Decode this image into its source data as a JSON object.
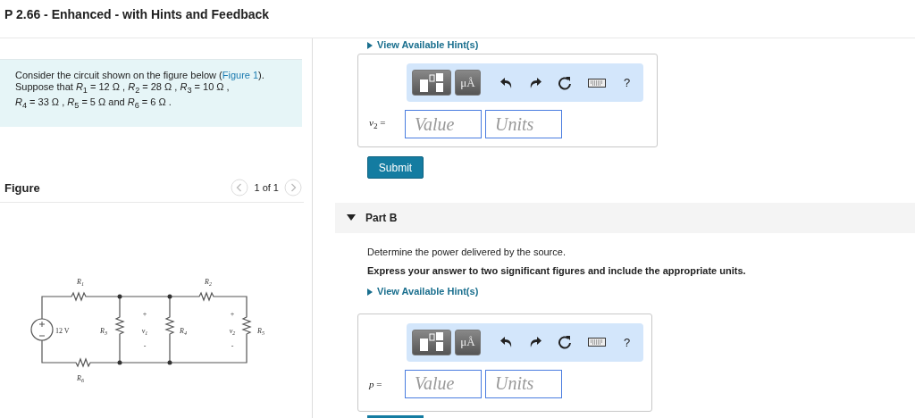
{
  "title": "P 2.66 - Enhanced - with Hints and Feedback",
  "problem": {
    "intro": "Consider the circuit shown on the figure below (",
    "link": "Figure 1",
    "intro_end": ").",
    "lines": [
      "Suppose that *R*$_{1}$ = 12 Ω , *R*$_{2}$ = 28 Ω , *R*$_{3}$ = 10 Ω ,",
      "*R*$_{4}$ = 33 Ω , *R*$_{5}$ = 5 Ω and *R*$_{6}$ = 6 Ω ."
    ]
  },
  "figure": {
    "label": "Figure",
    "pager": "1 of 1"
  },
  "circuit": {
    "source": "12 V",
    "labels": [
      {
        "main": "R",
        "sub": "1"
      },
      {
        "main": "R",
        "sub": "2"
      },
      {
        "main": "R",
        "sub": "6"
      },
      {
        "main": "R",
        "sub": "3"
      },
      {
        "main": "R",
        "sub": "4"
      },
      {
        "main": "R",
        "sub": "5"
      }
    ],
    "voltages": [
      {
        "main": "v",
        "sub": "1",
        "plus": "+",
        "minus": "-"
      },
      {
        "main": "v",
        "sub": "2",
        "plus": "+",
        "minus": "-"
      }
    ]
  },
  "part_a": {
    "hint_link": "View Available Hint(s)",
    "answer": {
      "units_button": "μÅ",
      "help": "?",
      "variable": "*v*$_{2}$ =",
      "value_placeholder": "Value",
      "units_placeholder": "Units"
    },
    "submit": "Submit"
  },
  "part_b": {
    "title": "Part B",
    "expanded": true,
    "question": "Determine the power delivered by the source.",
    "instruction": "Express your answer to two significant figures and include the appropriate units.",
    "hint_link": "View Available Hint(s)",
    "answer": {
      "units_button": "μÅ",
      "help": "?",
      "variable": "*p*  =",
      "value_placeholder": "Value",
      "units_placeholder": "Units"
    }
  }
}
